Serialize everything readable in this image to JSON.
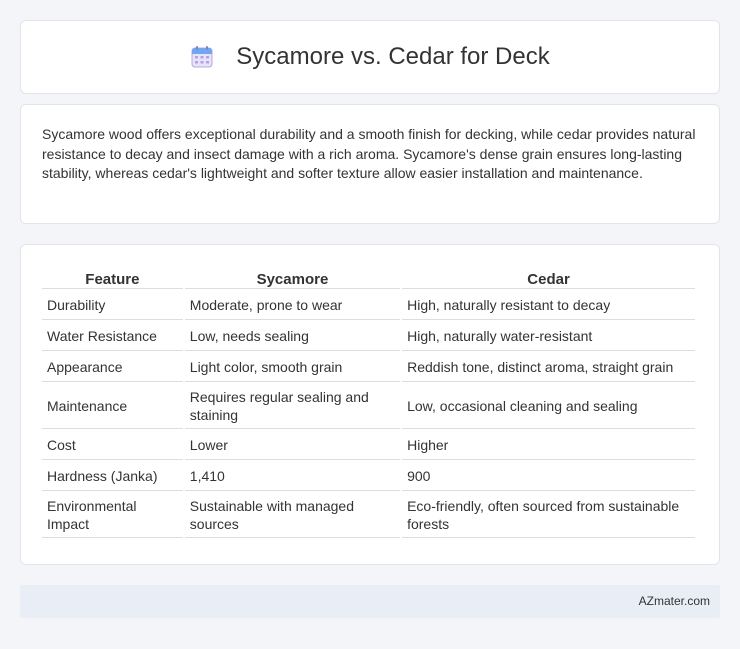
{
  "header": {
    "title": "Sycamore vs. Cedar for Deck",
    "icon": "calendar-icon"
  },
  "summary": {
    "text": "Sycamore wood offers exceptional durability and a smooth finish for decking, while cedar provides natural resistance to decay and insect damage with a rich aroma. Sycamore's dense grain ensures long-lasting stability, whereas cedar's lightweight and softer texture allow easier installation and maintenance."
  },
  "table": {
    "headers": [
      "Feature",
      "Sycamore",
      "Cedar"
    ],
    "rows": [
      [
        "Durability",
        "Moderate, prone to wear",
        "High, naturally resistant to decay"
      ],
      [
        "Water Resistance",
        "Low, needs sealing",
        "High, naturally water-resistant"
      ],
      [
        "Appearance",
        "Light color, smooth grain",
        "Reddish tone, distinct aroma, straight grain"
      ],
      [
        "Maintenance",
        "Requires regular sealing and staining",
        "Low, occasional cleaning and sealing"
      ],
      [
        "Cost",
        "Lower",
        "Higher"
      ],
      [
        "Hardness (Janka)",
        "1,410",
        "900"
      ],
      [
        "Environmental Impact",
        "Sustainable with managed sources",
        "Eco-friendly, often sourced from sustainable forests"
      ]
    ]
  },
  "footer": {
    "brand": "AZmater.com"
  },
  "colors": {
    "page_bg": "#f4f5f9",
    "card_bg": "#ffffff",
    "footer_bg": "#e8edf6",
    "icon_accent": "#8e7cc3"
  }
}
